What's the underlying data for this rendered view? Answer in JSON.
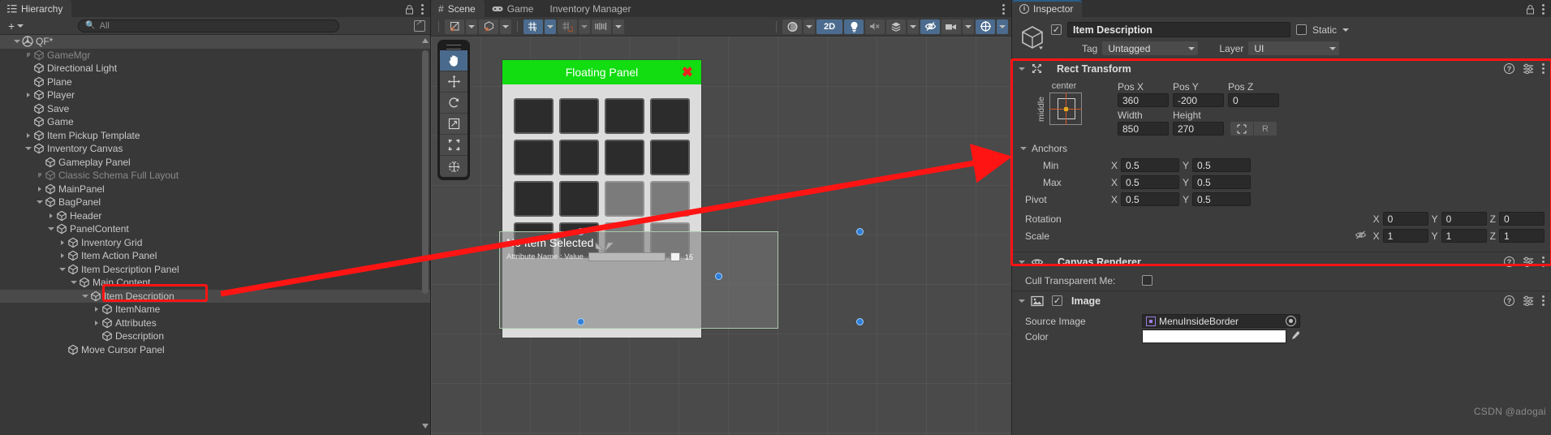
{
  "hierarchy": {
    "tab_label": "Hierarchy",
    "add_label": "+",
    "search_placeholder": "All",
    "search_value": "",
    "items": [
      {
        "label": "QF*",
        "depth": 0,
        "arrow": "open",
        "selected": true,
        "dim": false
      },
      {
        "label": "GameMgr",
        "depth": 1,
        "arrow": "closed",
        "selected": false,
        "dim": true
      },
      {
        "label": "Directional Light",
        "depth": 1,
        "arrow": "none",
        "selected": false,
        "dim": false
      },
      {
        "label": "Plane",
        "depth": 1,
        "arrow": "none",
        "selected": false,
        "dim": false
      },
      {
        "label": "Player",
        "depth": 1,
        "arrow": "closed",
        "selected": false,
        "dim": false
      },
      {
        "label": "Save",
        "depth": 1,
        "arrow": "none",
        "selected": false,
        "dim": false
      },
      {
        "label": "Game",
        "depth": 1,
        "arrow": "none",
        "selected": false,
        "dim": false
      },
      {
        "label": "Item Pickup Template",
        "depth": 1,
        "arrow": "closed",
        "selected": false,
        "dim": false
      },
      {
        "label": "Inventory Canvas",
        "depth": 1,
        "arrow": "open",
        "selected": false,
        "dim": false
      },
      {
        "label": "Gameplay Panel",
        "depth": 2,
        "arrow": "none",
        "selected": false,
        "dim": false
      },
      {
        "label": "Classic Schema Full Layout",
        "depth": 2,
        "arrow": "closed",
        "selected": false,
        "dim": true
      },
      {
        "label": "MainPanel",
        "depth": 2,
        "arrow": "closed",
        "selected": false,
        "dim": false
      },
      {
        "label": "BagPanel",
        "depth": 2,
        "arrow": "open",
        "selected": false,
        "dim": false
      },
      {
        "label": "Header",
        "depth": 3,
        "arrow": "closed",
        "selected": false,
        "dim": false
      },
      {
        "label": "PanelContent",
        "depth": 3,
        "arrow": "open",
        "selected": false,
        "dim": false
      },
      {
        "label": "Inventory Grid",
        "depth": 4,
        "arrow": "closed",
        "selected": false,
        "dim": false
      },
      {
        "label": "Item Action Panel",
        "depth": 4,
        "arrow": "closed",
        "selected": false,
        "dim": false
      },
      {
        "label": "Item Description Panel",
        "depth": 4,
        "arrow": "open",
        "selected": false,
        "dim": false
      },
      {
        "label": "Main Content",
        "depth": 5,
        "arrow": "open",
        "selected": false,
        "dim": false
      },
      {
        "label": "Item Description",
        "depth": 6,
        "arrow": "open",
        "selected": true,
        "dim": false
      },
      {
        "label": "ItemName",
        "depth": 7,
        "arrow": "closed",
        "selected": false,
        "dim": false
      },
      {
        "label": "Attributes",
        "depth": 7,
        "arrow": "closed",
        "selected": false,
        "dim": false
      },
      {
        "label": "Description",
        "depth": 7,
        "arrow": "none",
        "selected": false,
        "dim": false
      },
      {
        "label": "Move Cursor Panel",
        "depth": 4,
        "arrow": "none",
        "selected": false,
        "dim": false
      }
    ]
  },
  "scene": {
    "tabs": [
      {
        "label": "Scene",
        "icon": "hash-icon",
        "active": true
      },
      {
        "label": "Game",
        "icon": "gamepad-icon",
        "active": false
      },
      {
        "label": "Inventory Manager",
        "icon": "",
        "active": false
      }
    ],
    "toolbar": {
      "draw_mode_label": "",
      "shading_label": "",
      "two_d_label": "2D",
      "buttons": [
        "shaded-mode-dropdown",
        "gizmo-mode-dropdown",
        "2d-toggle",
        "lighting-toggle",
        "audio-toggle",
        "fx-dropdown",
        "visibility-toggle",
        "camera-dropdown",
        "gizmos-dropdown"
      ]
    },
    "tools": [
      {
        "name": "hand-tool",
        "glyph": "✋",
        "active": true
      },
      {
        "name": "move-tool",
        "glyph": "✥",
        "active": false
      },
      {
        "name": "rotate-tool",
        "glyph": "⟳",
        "active": false
      },
      {
        "name": "scale-tool",
        "glyph": "⤢",
        "active": false
      },
      {
        "name": "rect-tool",
        "glyph": "⬚",
        "active": false
      },
      {
        "name": "transform-tool",
        "glyph": "✣",
        "active": false
      }
    ],
    "floating_panel": {
      "title": "Floating Panel",
      "close_label": "✖",
      "header_color": "#11dd11",
      "slot_count": 16
    },
    "description_overlay": {
      "title": "No Item Selected",
      "attribute_label": "Attribute Name : Value",
      "attribute_value": "15"
    }
  },
  "inspector": {
    "tab_label": "Inspector",
    "object": {
      "enabled": true,
      "name": "Item Description",
      "static_label": "Static",
      "static_checked": false,
      "tag_label": "Tag",
      "tag_value": "Untagged",
      "layer_label": "Layer",
      "layer_value": "UI"
    },
    "components": [
      {
        "name": "Rect Transform",
        "icon": "rect-transform-icon",
        "highlighted": true,
        "anchor_preset": {
          "horizontal": "center",
          "vertical": "middle"
        },
        "columns": [
          "Pos X",
          "Pos Y",
          "Pos Z"
        ],
        "pos": {
          "x": "360",
          "y": "-200",
          "z": "0"
        },
        "size_columns": [
          "Width",
          "Height"
        ],
        "size": {
          "width": "850",
          "height": "270"
        },
        "blueprint_label": "",
        "raw_label": "R",
        "anchors_label": "Anchors",
        "min_label": "Min",
        "min": {
          "x": "0.5",
          "y": "0.5"
        },
        "max_label": "Max",
        "max": {
          "x": "0.5",
          "y": "0.5"
        },
        "pivot_label": "Pivot",
        "pivot": {
          "x": "0.5",
          "y": "0.5"
        },
        "rotation_label": "Rotation",
        "rotation": {
          "x": "0",
          "y": "0",
          "z": "0"
        },
        "scale_label": "Scale",
        "scale": {
          "x": "1",
          "y": "1",
          "z": "1"
        }
      },
      {
        "name": "Canvas Renderer",
        "icon": "eye-icon",
        "highlighted": false,
        "cull_label": "Cull Transparent Me:",
        "cull_checked": false
      },
      {
        "name": "Image",
        "icon": "image-icon",
        "highlighted": false,
        "enabled": true,
        "source_image_label": "Source Image",
        "source_image_value": "MenuInsideBorder",
        "color_label": "Color"
      }
    ]
  },
  "watermark": "CSDN @adogai",
  "colors": {
    "accent_blue": "#4b6c8e",
    "annotation_red": "#ff1414",
    "panel_green": "#11dd11",
    "handle_blue": "#2f7fd8",
    "bg_dark": "#383838",
    "bg_panel": "#3c3c3c"
  }
}
